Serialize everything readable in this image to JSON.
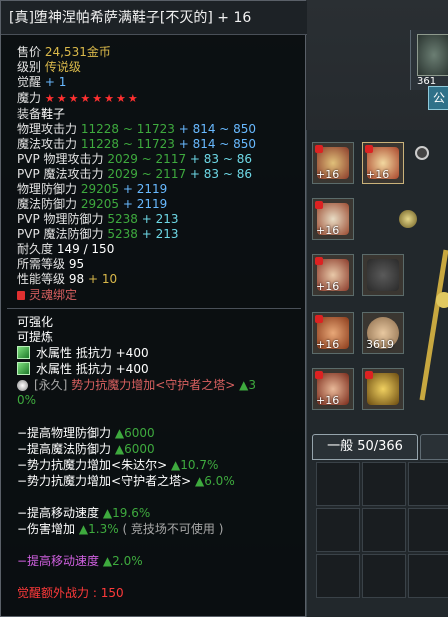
{
  "item": {
    "title": "[真]堕神涅帕希萨满鞋子[不灭的] + 16",
    "price_label": "售价",
    "price_value": "24,531金币",
    "level_label": "级别",
    "level_value": "传说级",
    "awaken_label": "觉醒",
    "awaken_value": "+ 1",
    "magic_label": "魔力",
    "magic_stars": "★★★★★★★★",
    "equip_label": "装备",
    "equip_value": "鞋子",
    "stats": [
      {
        "label": "物理攻击力",
        "base": "11228 ~ 11723",
        "bonus": "+ 814 ~ 850"
      },
      {
        "label": "魔法攻击力",
        "base": "11228 ~ 11723",
        "bonus": "+ 814 ~ 850"
      },
      {
        "label": "PVP 物理攻击力",
        "base": "2029 ~ 2117",
        "bonus": "+ 83 ~ 86"
      },
      {
        "label": "PVP 魔法攻击力",
        "base": "2029 ~ 2117",
        "bonus": "+ 83 ~ 86"
      },
      {
        "label": "物理防御力",
        "base": "29205",
        "bonus": "+ 2119"
      },
      {
        "label": "魔法防御力",
        "base": "29205",
        "bonus": "+ 2119"
      },
      {
        "label": "PVP 物理防御力",
        "base": "5238",
        "bonus": "+ 213"
      },
      {
        "label": "PVP 魔法防御力",
        "base": "5238",
        "bonus": "+ 213"
      }
    ],
    "durability_label": "耐久度",
    "durability_value": "149 / 150",
    "req_level_label": "所需等级",
    "req_level_value": "95",
    "perf_label": "性能等级",
    "perf_value": "98",
    "perf_bonus": "+ 10",
    "soulbound": "灵魂绑定",
    "enhanceable": "可强化",
    "refinable": "可提炼",
    "gems": [
      {
        "text": "水属性 抵抗力 +400"
      },
      {
        "text": "水属性 抵抗力 +400"
      }
    ],
    "permanent_prefix": "[永久]",
    "permanent_text": "势力抗魔力增加<守护者之塔>",
    "permanent_bonus_a": "▲3",
    "permanent_bonus_b": "0%",
    "set_bonuses_1": [
      {
        "label": "−提高物理防御力",
        "value": "▲6000"
      },
      {
        "label": "−提高魔法防御力",
        "value": "▲6000"
      },
      {
        "label": "−势力抗魔力增加<朱达尔>",
        "value": "▲10.7%"
      },
      {
        "label": "−势力抗魔力增加<守护者之塔>",
        "value": "▲6.0%"
      }
    ],
    "set_bonuses_2": [
      {
        "label": "−提高移动速度",
        "value": "▲19.6%",
        "note": ""
      },
      {
        "label": "−伤害增加",
        "value": "▲1.3%",
        "note": "( 竞技场不可使用 )"
      }
    ],
    "set_bonus_magenta": {
      "label": "−提高移动速度",
      "value": "▲2.0%"
    },
    "awaken_power_label": "觉醒额外战力 :",
    "awaken_power_value": "150"
  },
  "inventory": {
    "top_count": "361",
    "public_tab": "公",
    "tab_general": "一般 50/366",
    "slot_counts": [
      "+16",
      "+16",
      "+16",
      "+16",
      "+16",
      "3619",
      "+16"
    ]
  },
  "colors": {
    "gold": "#d9b84a",
    "blue": "#68b9ff",
    "green": "#3eaa3e",
    "cyan": "#6ed8e6",
    "red": "#ff4a4a"
  }
}
